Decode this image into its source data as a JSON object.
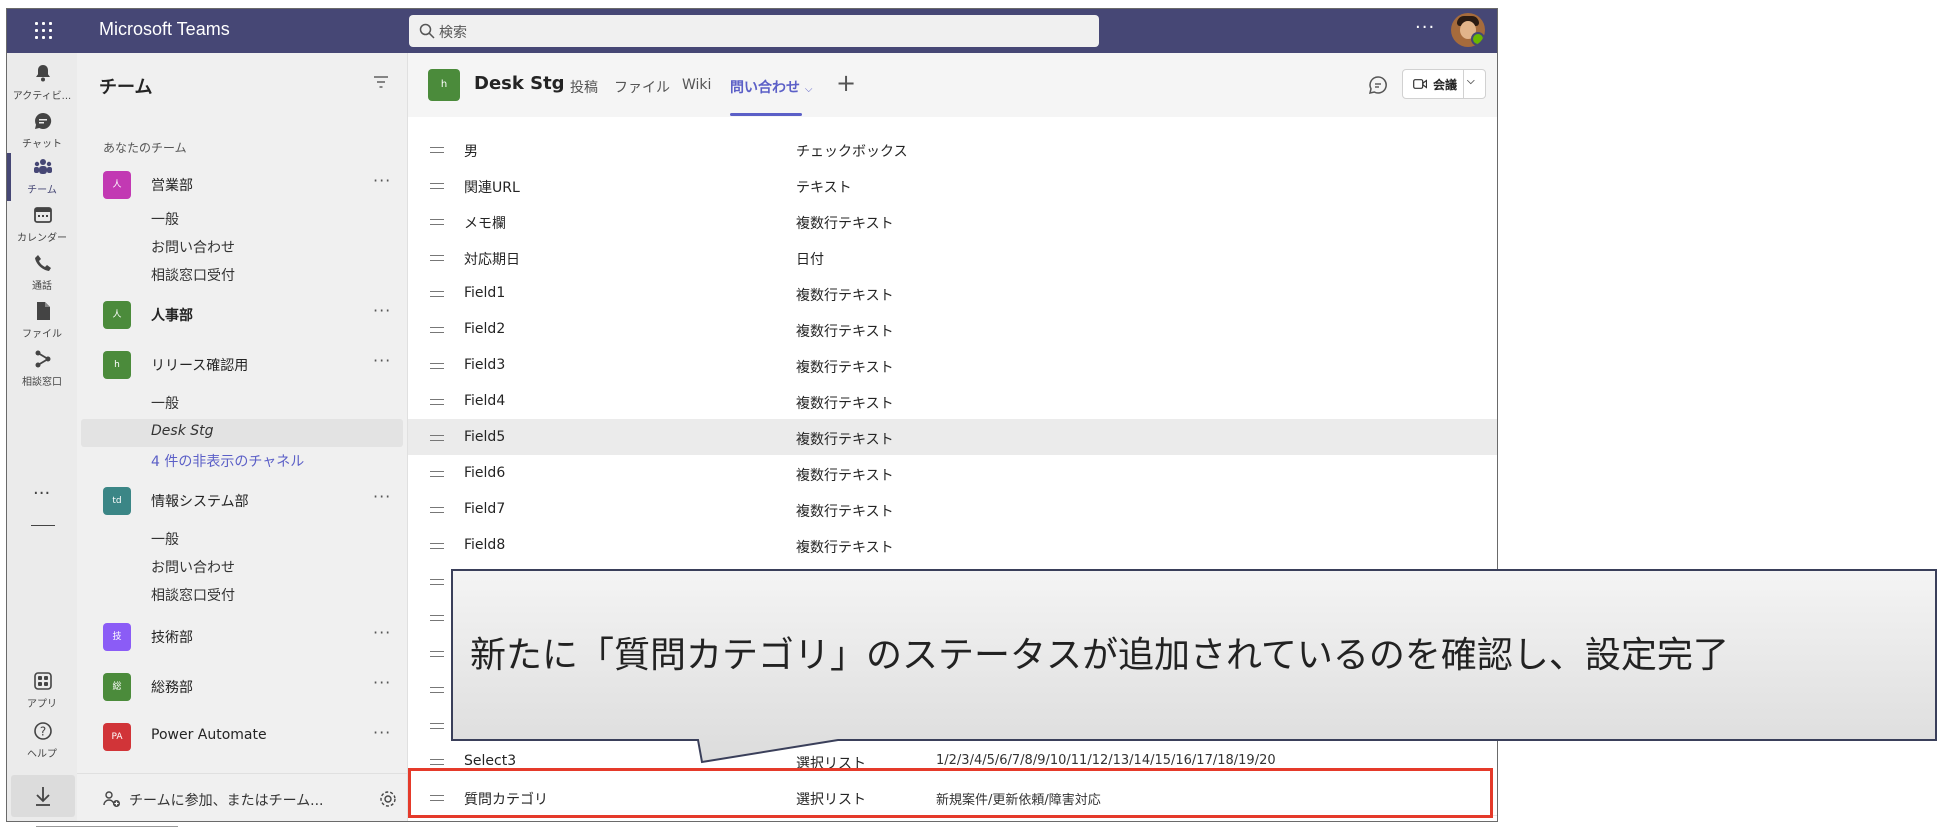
{
  "titlebar": {
    "app_name": "Microsoft Teams",
    "search_placeholder": "検索",
    "more": "···"
  },
  "rail": {
    "items": [
      {
        "label": "アクティビ...",
        "icon": "bell-icon"
      },
      {
        "label": "チャット",
        "icon": "chat-icon"
      },
      {
        "label": "チーム",
        "icon": "teams-icon",
        "active": true
      },
      {
        "label": "カレンダー",
        "icon": "calendar-icon"
      },
      {
        "label": "通話",
        "icon": "phone-icon"
      },
      {
        "label": "ファイル",
        "icon": "file-icon"
      },
      {
        "label": "相談窓口",
        "icon": "app-icon"
      }
    ],
    "more": "···",
    "bottom": [
      {
        "label": "アプリ",
        "icon": "apps-icon"
      },
      {
        "label": "ヘルプ",
        "icon": "help-icon"
      }
    ]
  },
  "panel": {
    "title": "チーム",
    "section": "あなたのチーム",
    "teams": [
      {
        "name": "営業部",
        "tile_text": "人",
        "color": "#c239b3",
        "bold": false,
        "channels": [
          "一般",
          "お問い合わせ",
          "相談窓口受付"
        ]
      },
      {
        "name": "人事部",
        "tile_text": "人",
        "color": "#4b8b3b",
        "bold": true,
        "channels": []
      },
      {
        "name": "リリース確認用",
        "tile_text": "h",
        "color": "#4b8b3b",
        "bold": false,
        "channels": [
          "一般",
          "Desk Stg"
        ],
        "hidden_link": "4 件の非表示のチャネル"
      },
      {
        "name": "情報システム部",
        "tile_text": "td",
        "color": "#3b8686",
        "bold": false,
        "channels": [
          "一般",
          "お問い合わせ",
          "相談窓口受付"
        ]
      },
      {
        "name": "技術部",
        "tile_text": "技",
        "color": "#8b5cf6",
        "bold": false,
        "channels": []
      },
      {
        "name": "総務部",
        "tile_text": "総",
        "color": "#4b8b3b",
        "bold": false,
        "channels": []
      },
      {
        "name": "Power Automate",
        "tile_text": "PA",
        "color": "#d13438",
        "bold": false,
        "channels": []
      }
    ],
    "more": "···",
    "join_text": "チームに参加、またはチーム..."
  },
  "main": {
    "channel_tile": "h",
    "channel_title": "Desk Stg",
    "tabs": [
      "投稿",
      "ファイル",
      "Wiki",
      "問い合わせ"
    ],
    "active_tab_chevron": "⌵",
    "tab_plus": "+",
    "meet_label": "会議",
    "rows": [
      {
        "name": "男",
        "type": "チェックボックス",
        "options": ""
      },
      {
        "name": "関連URL",
        "type": "テキスト",
        "options": ""
      },
      {
        "name": "メモ欄",
        "type": "複数行テキスト",
        "options": ""
      },
      {
        "name": "対応期日",
        "type": "日付",
        "options": ""
      },
      {
        "name": "Field1",
        "type": "複数行テキスト",
        "options": ""
      },
      {
        "name": "Field2",
        "type": "複数行テキスト",
        "options": ""
      },
      {
        "name": "Field3",
        "type": "複数行テキスト",
        "options": ""
      },
      {
        "name": "Field4",
        "type": "複数行テキスト",
        "options": ""
      },
      {
        "name": "Field5",
        "type": "複数行テキスト",
        "options": "",
        "highlight": true
      },
      {
        "name": "Field6",
        "type": "複数行テキスト",
        "options": ""
      },
      {
        "name": "Field7",
        "type": "複数行テキスト",
        "options": ""
      },
      {
        "name": "Field8",
        "type": "複数行テキスト",
        "options": ""
      },
      {
        "name": "",
        "type": "",
        "options": ""
      },
      {
        "name": "",
        "type": "",
        "options": ""
      },
      {
        "name": "",
        "type": "",
        "options": ""
      },
      {
        "name": "",
        "type": "",
        "options": ""
      },
      {
        "name": "",
        "type": "",
        "options": ""
      },
      {
        "name": "Select3",
        "type": "選択リスト",
        "options": "1/2/3/4/5/6/7/8/9/10/11/12/13/14/15/16/17/18/19/20"
      },
      {
        "name": "質問カテゴリ",
        "type": "選択リスト",
        "options": "新規案件/更新依頼/障害対応"
      }
    ]
  },
  "callout": {
    "text": "新たに「質問カテゴリ」のステータスが追加されているのを確認し、設定完了"
  }
}
